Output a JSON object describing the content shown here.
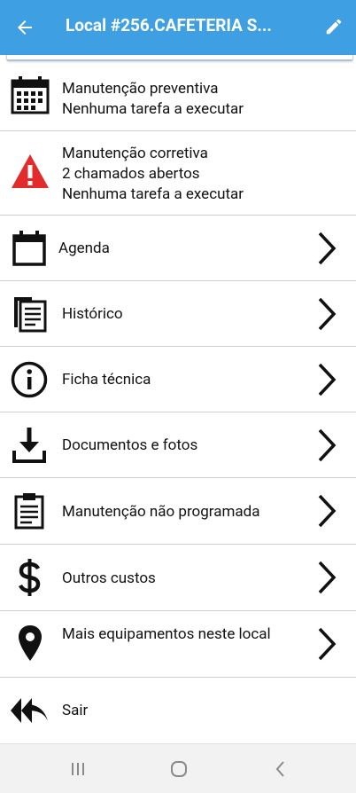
{
  "appbar": {
    "title": "Local #256.CAFETERIA S...",
    "back_icon": "arrow-left-icon",
    "edit_icon": "pencil-icon",
    "color": "#3f9fe3"
  },
  "preventive": {
    "title": "Manutenção preventiva",
    "status": "Nenhuma tarefa a executar",
    "icon": "calendar-grid-icon"
  },
  "corrective": {
    "title": "Manutenção corretiva",
    "calls": "2 chamados abertos",
    "status": "Nenhuma tarefa a executar",
    "icon": "warning-triangle-icon",
    "icon_color": "#e32b2b"
  },
  "menu": [
    {
      "label": "Agenda",
      "icon": "calendar-icon"
    },
    {
      "label": "Histórico",
      "icon": "documents-icon"
    },
    {
      "label": "Ficha técnica",
      "icon": "info-icon"
    },
    {
      "label": "Documentos e fotos",
      "icon": "download-icon"
    },
    {
      "label": "Manutenção não programada",
      "icon": "clipboard-icon"
    },
    {
      "label": "Outros custos",
      "icon": "dollar-icon"
    },
    {
      "label": "Mais equipamentos neste local",
      "icon": "map-pin-icon"
    }
  ],
  "exit": {
    "label": "Sair",
    "icon": "double-reply-icon"
  },
  "system_nav": {
    "recents": "recents-icon",
    "home": "home-icon",
    "back": "back-icon"
  }
}
